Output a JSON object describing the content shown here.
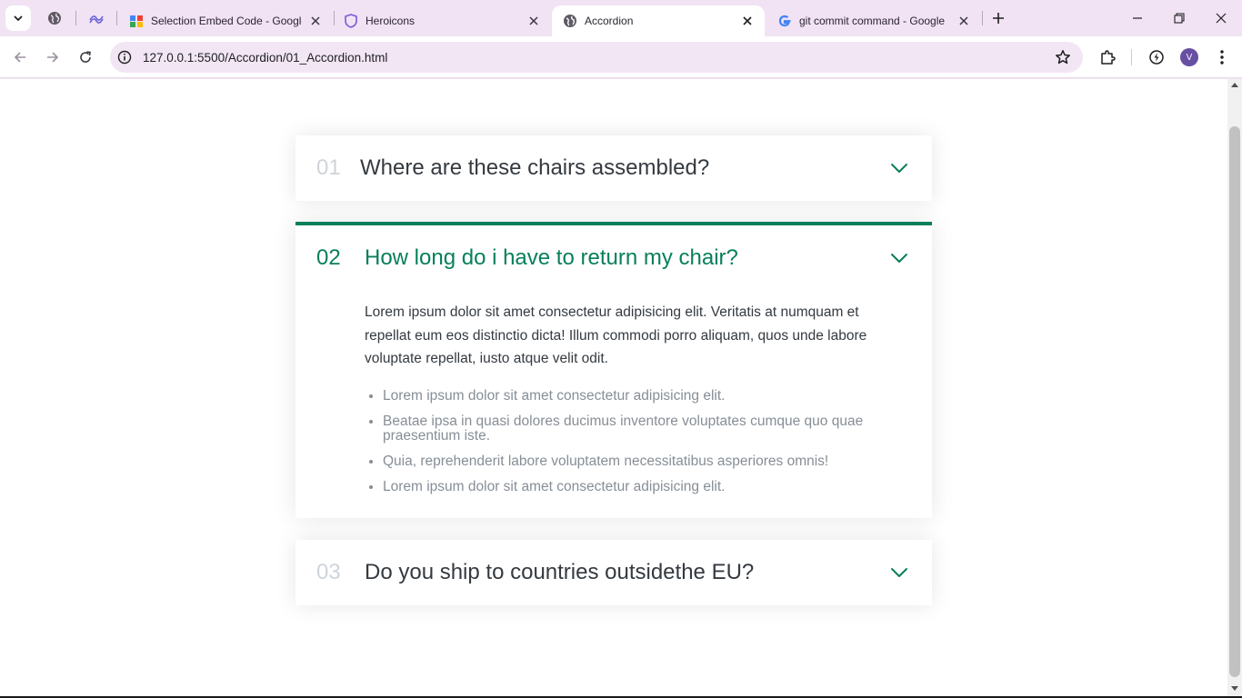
{
  "browser": {
    "tabs": [
      {
        "title": "Selection Embed Code - Google",
        "icon": "google-drive-icon"
      },
      {
        "title": "Heroicons",
        "icon": "shield-icon"
      },
      {
        "title": "Accordion",
        "icon": "globe-icon",
        "active": true
      },
      {
        "title": "git commit command - Google",
        "icon": "google-icon"
      }
    ],
    "url": "127.0.0.1:5500/Accordion/01_Accordion.html",
    "profile_initial": "V"
  },
  "accordion": {
    "accent_color": "#087f5b",
    "items": [
      {
        "number": "01",
        "question": "Where are these chairs assembled?",
        "open": false
      },
      {
        "number": "02",
        "question": "How long do i have to return my chair?",
        "open": true,
        "answer": "Lorem ipsum dolor sit amet consectetur adipisicing elit. Veritatis at numquam et repellat eum eos distinctio dicta! Illum commodi porro aliquam, quos unde labore voluptate repellat, iusto atque velit odit.",
        "bullets": [
          "Lorem ipsum dolor sit amet consectetur adipisicing elit.",
          "Beatae ipsa in quasi dolores ducimus inventore voluptates cumque quo quae praesentium iste.",
          "Quia, reprehenderit labore voluptatem necessitatibus asperiores omnis!",
          "Lorem ipsum dolor sit amet consectetur adipisicing elit."
        ]
      },
      {
        "number": "03",
        "question": "Do you ship to countries outsidethe EU?",
        "open": false
      }
    ]
  }
}
